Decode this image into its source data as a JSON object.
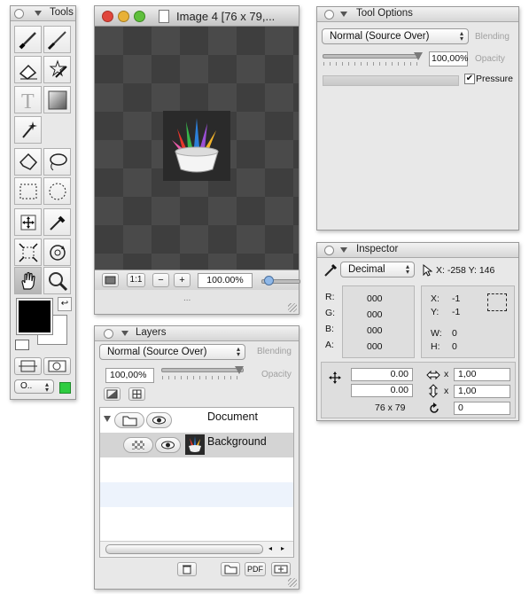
{
  "tools_panel": {
    "title": "Tools",
    "bottom_popup": "O..",
    "tools": [
      "brush-icon",
      "pen-brush-icon",
      "eraser-icon",
      "star-stamp-icon",
      "text-icon",
      "gradient-icon",
      "magic-wand-icon",
      "polygon-lasso-icon",
      "lasso-icon",
      "rect-select-icon",
      "ellipse-select-icon",
      "move-icon",
      "eyedropper-icon",
      "transform-icon",
      "rotate-icon",
      "hand-icon",
      "zoom-icon"
    ],
    "colors": {
      "foreground": "#000000",
      "background": "#ffffff",
      "accent": "#2ecc40"
    }
  },
  "image_window": {
    "title": "Image 4 [76 x 79,...",
    "zoom_button": "1:1",
    "zoom_out": "−",
    "zoom_in": "+",
    "zoom_value": "100.00%",
    "status": "..."
  },
  "tool_options": {
    "title": "Tool Options",
    "blend_mode": "Normal (Source Over)",
    "blending_label": "Blending",
    "opacity_value": "100,00%",
    "opacity_label": "Opacity",
    "pressure_label": "Pressure",
    "pressure_checked": true,
    "opacity_level": 1.0
  },
  "layers": {
    "title": "Layers",
    "blend_mode": "Normal (Source Over)",
    "blending_label": "Blending",
    "opacity_value": "100,00%",
    "opacity_label": "Opacity",
    "items": [
      {
        "name": "Document",
        "type": "group"
      },
      {
        "name": "Background",
        "type": "layer"
      }
    ],
    "pdf_label": "PDF"
  },
  "inspector": {
    "title": "Inspector",
    "unit": "Decimal",
    "cursor_pos": "X: -258 Y: 146",
    "color": {
      "r_label": "R:",
      "g_label": "G:",
      "b_label": "B:",
      "a_label": "A:",
      "r": "000",
      "g": "000",
      "b": "000",
      "a": "000"
    },
    "selection": {
      "x_label": "X:",
      "y_label": "Y:",
      "w_label": "W:",
      "h_label": "H:",
      "x": "-1",
      "y": "-1",
      "w": "0",
      "h": "0"
    },
    "offset_x": "0.00",
    "offset_y": "0.00",
    "scale_x_sep": "x",
    "scale_y_sep": "x",
    "scale_x": "1,00",
    "scale_y": "1,00",
    "size": "76 x 79",
    "rotation": "0"
  }
}
